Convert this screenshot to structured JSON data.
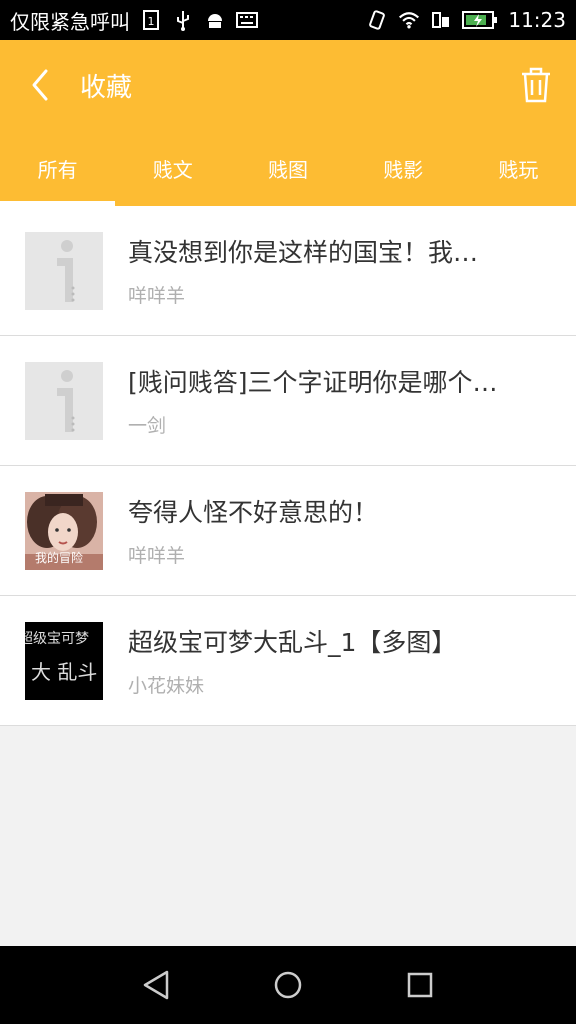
{
  "status_bar": {
    "carrier": "仅限紧急呼叫",
    "time": "11:23"
  },
  "app_bar": {
    "title": "收藏"
  },
  "tabs": [
    {
      "label": "所有"
    },
    {
      "label": "贱文"
    },
    {
      "label": "贱图"
    },
    {
      "label": "贱影"
    },
    {
      "label": "贱玩"
    }
  ],
  "items": [
    {
      "title": "真没想到你是这样的国宝！我…",
      "author": "咩咩羊",
      "thumb": "placeholder"
    },
    {
      "title": "[贱问贱答]三个字证明你是哪个…",
      "author": "一剑",
      "thumb": "placeholder"
    },
    {
      "title": "夸得人怪不好意思的！",
      "author": "咩咩羊",
      "thumb": "photo"
    },
    {
      "title": "超级宝可梦大乱斗_1【多图】",
      "author": "小花妹妹",
      "thumb": "dark-text"
    }
  ],
  "thumb_texts": {
    "item3_overlay": "我的冒险",
    "item4_line1": "超级宝可梦",
    "item4_line2": "大 乱斗"
  },
  "colors": {
    "accent": "#fdbc33",
    "title_text": "#333333",
    "sub_text": "#b0b0b0"
  },
  "icons": {
    "back": "chevron-left-icon",
    "trash": "trash-icon",
    "nav_back": "triangle-back-icon",
    "nav_home": "circle-home-icon",
    "nav_recent": "square-recent-icon"
  }
}
